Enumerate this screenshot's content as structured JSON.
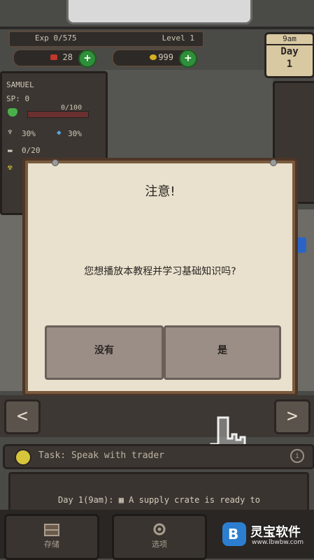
{
  "hud": {
    "exp_label": "Exp 0/575",
    "level_label": "Level 1",
    "meat_value": "28",
    "gold_value": "999",
    "plus": "+"
  },
  "day_badge": {
    "time": "9am",
    "day_word": "Day",
    "day_num": "1"
  },
  "character": {
    "name": "SAMUEL",
    "sp": "SP: 0",
    "hp": "0/100",
    "hunger": "30%",
    "thirst": "30%",
    "carry": "0/20"
  },
  "dialog": {
    "title": "注意!",
    "message": "您想播放本教程并学习基础知识吗?",
    "no_label": "没有",
    "yes_label": "是"
  },
  "nav_arrows": {
    "left": "<",
    "right": ">"
  },
  "task": {
    "text": "Task: Speak with trader",
    "info": "i"
  },
  "log": {
    "entry": "Day 1(9am): ▦ A supply crate is ready to"
  },
  "bottom_nav": {
    "storage_label": "存储",
    "options_label": "选项"
  },
  "watermark": {
    "logo": "B",
    "title": "灵宝软件",
    "url": "www.lbwbw.com"
  },
  "colors": {
    "accent_green": "#2f8f3a",
    "dialog_bg": "#e9e1cd",
    "frame_brown": "#7a5b3d"
  }
}
